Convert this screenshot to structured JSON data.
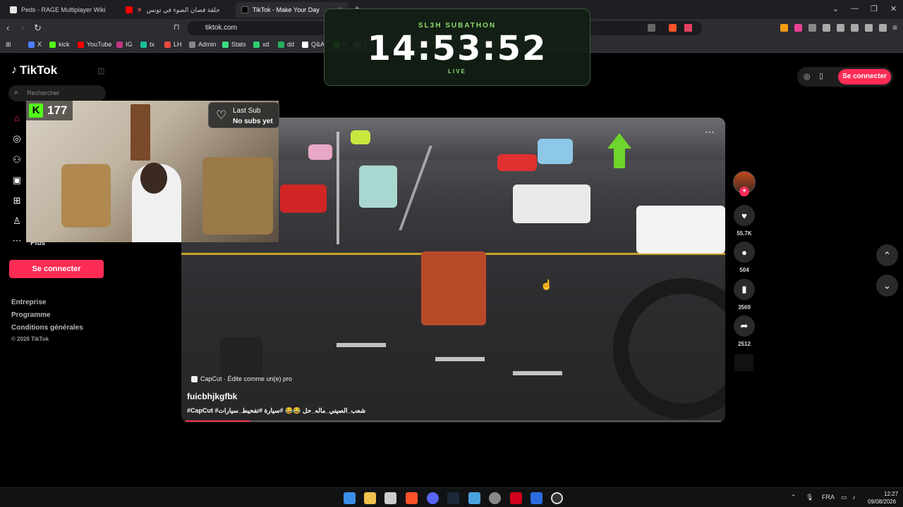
{
  "browser": {
    "tabs": [
      {
        "label": "Peds - RAGE Multiplayer Wiki",
        "color": "#ffffff"
      },
      {
        "label": "حلقة فصان الضوء في تونس",
        "color": "#ff0000"
      },
      {
        "label": "TikTok - Make Your Day",
        "color": "#ffffff"
      }
    ],
    "url": "tiktok.com",
    "bookmarks": [
      {
        "label": "X",
        "color": "#4c7cff"
      },
      {
        "label": "kick",
        "color": "#53fc18"
      },
      {
        "label": "YouTube",
        "color": "#ff0000"
      },
      {
        "label": "IG",
        "color": "#c13584"
      },
      {
        "label": "tx",
        "color": "#1abc9c"
      },
      {
        "label": "LH",
        "color": "#e74c3c"
      },
      {
        "label": "Admin",
        "color": "#888888"
      },
      {
        "label": "Stats",
        "color": "#3ddc84"
      },
      {
        "label": "xd",
        "color": "#2ecc71"
      },
      {
        "label": "dd",
        "color": "#27ae60"
      },
      {
        "label": "Q&A",
        "color": "#ffffff"
      },
      {
        "label": "K",
        "color": "#53fc18"
      },
      {
        "label": "2",
        "color": "#888888"
      }
    ]
  },
  "subathon": {
    "title": "SL3H SUBATHON",
    "time": "14:53:52",
    "status": "LIVE"
  },
  "sidebar": {
    "logo": "TikTok",
    "search_placeholder": "Rechercher",
    "more_label": "Plus",
    "login_label": "Se connecter",
    "footer_links": [
      "Entreprise",
      "Programme",
      "Conditions générales"
    ],
    "copyright": "© 2026 TikTok"
  },
  "webcam": {
    "kick_count": "177",
    "last_sub_title": "Last Sub",
    "last_sub_value": "No subs yet"
  },
  "video": {
    "credit": "CapCut · Édite comme un(e) pro",
    "username": "fuicbhjkgfbk",
    "tags": "#CapCut #شعب_الصيني_ماله_حل 😂😂 #سيارة #تفحيط_سيارات",
    "progress": 0.12
  },
  "actions": {
    "likes": "55.7K",
    "comments": "504",
    "saves": "3569",
    "shares": "2512"
  },
  "header": {
    "login_label": "Se connecter"
  },
  "taskbar": {
    "language": "FRA",
    "time": "12:27",
    "date": "09/08/2026"
  },
  "colors": {
    "accent": "#fe2c55",
    "kick": "#53fc18",
    "subathon_text": "#8fdc6f"
  }
}
